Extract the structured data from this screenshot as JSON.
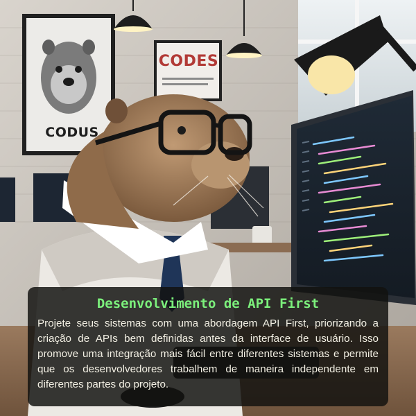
{
  "posters": {
    "left_text": "CODUS",
    "right_text": "CODES"
  },
  "caption": {
    "title": "Desenvolvimento de API First",
    "body": "Projete seus sistemas com uma abordagem API First, priorizando a criação de APIs bem definidas antes da interface de usuário. Isso promove uma integração mais fácil entre diferentes sistemas e permite que os desenvolvedores trabalhem de maneira independente em diferentes partes do projeto."
  },
  "colors": {
    "title_green": "#7cf07c",
    "caption_background": "#121210",
    "body_text": "#f2efe3"
  }
}
